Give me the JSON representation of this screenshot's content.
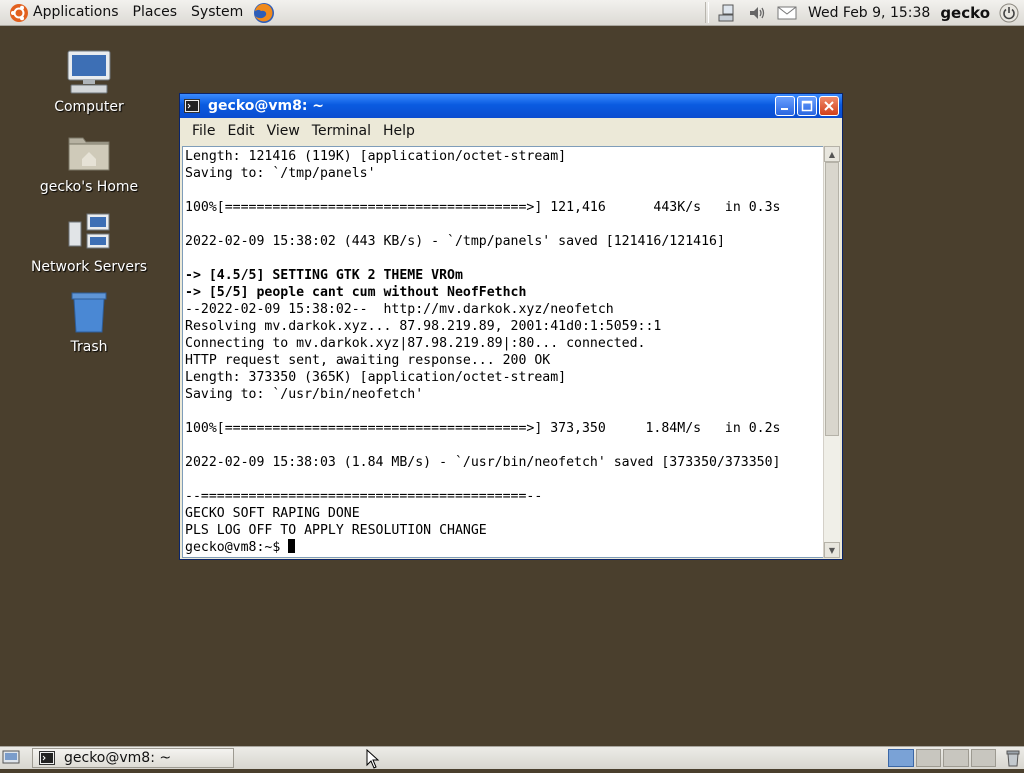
{
  "top_panel": {
    "menus": [
      "Applications",
      "Places",
      "System"
    ],
    "clock": "Wed Feb  9, 15:38",
    "username": "gecko"
  },
  "desktop_icons": [
    {
      "label": "Computer",
      "icon": "computer-icon"
    },
    {
      "label": "gecko's Home",
      "icon": "home-folder-icon"
    },
    {
      "label": "Network Servers",
      "icon": "network-servers-icon"
    },
    {
      "label": "Trash",
      "icon": "trash-icon"
    }
  ],
  "terminal": {
    "title": "gecko@vm8: ~",
    "menu": [
      "File",
      "Edit",
      "View",
      "Terminal",
      "Help"
    ],
    "lines": [
      "Length: 121416 (119K) [application/octet-stream]",
      "Saving to: `/tmp/panels'",
      "",
      "100%[======================================>] 121,416      443K/s   in 0.3s",
      "",
      "2022-02-09 15:38:02 (443 KB/s) - `/tmp/panels' saved [121416/121416]",
      "",
      "-> [4.5/5] SETTING GTK 2 THEME VROm",
      "-> [5/5] people cant cum without NeofFethch",
      "--2022-02-09 15:38:02--  http://mv.darkok.xyz/neofetch",
      "Resolving mv.darkok.xyz... 87.98.219.89, 2001:41d0:1:5059::1",
      "Connecting to mv.darkok.xyz|87.98.219.89|:80... connected.",
      "HTTP request sent, awaiting response... 200 OK",
      "Length: 373350 (365K) [application/octet-stream]",
      "Saving to: `/usr/bin/neofetch'",
      "",
      "100%[======================================>] 373,350     1.84M/s   in 0.2s",
      "",
      "2022-02-09 15:38:03 (1.84 MB/s) - `/usr/bin/neofetch' saved [373350/373350]",
      "",
      "--=========================================--",
      "GECKO SOFT RAPING DONE",
      "PLS LOG OFF TO APPLY RESOLUTION CHANGE"
    ],
    "prompt": "gecko@vm8:~$ "
  },
  "bottom_panel": {
    "task_label": "gecko@vm8: ~",
    "workspaces": 4,
    "active_workspace": 1
  },
  "colors": {
    "desktop_bg": "#4a3f2d",
    "titlebar": "#0a5be0",
    "panel": "#dcdad4"
  }
}
